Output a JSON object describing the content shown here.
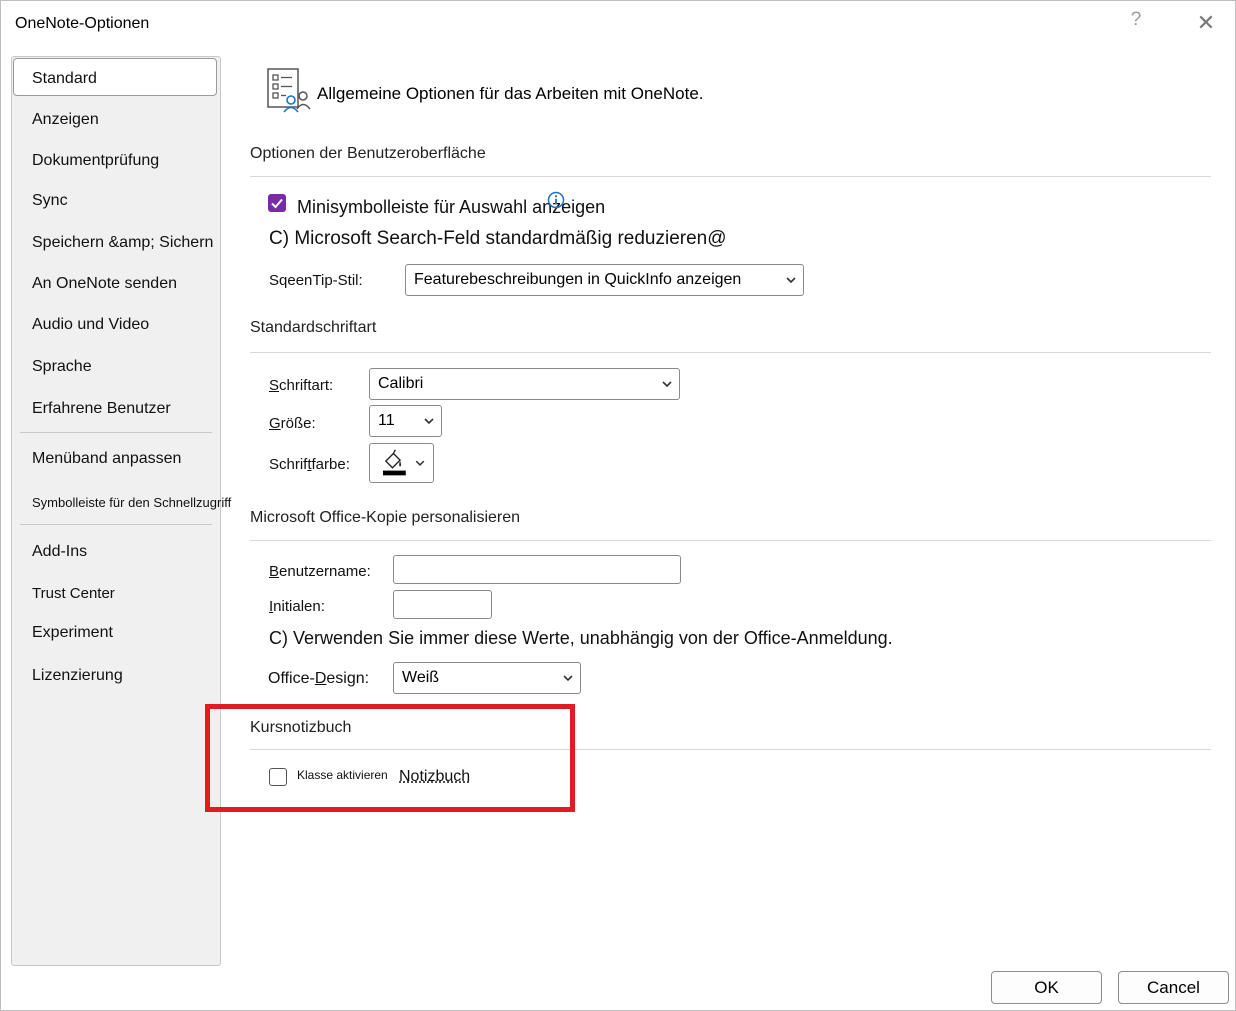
{
  "window": {
    "title": "OneNote-Optionen",
    "help_label": "?",
    "close_label": "✕"
  },
  "sidebar": {
    "items": [
      {
        "label": "Standard"
      },
      {
        "label": "Anzeigen"
      },
      {
        "label": "Dokumentprüfung"
      },
      {
        "label": "Sync"
      },
      {
        "label": "Speichern &amp; Sichern"
      },
      {
        "label": "An OneNote senden"
      },
      {
        "label": "Audio und Video"
      },
      {
        "label": "Sprache"
      },
      {
        "label": "Erfahrene Benutzer"
      },
      {
        "label": "Menüband anpassen"
      },
      {
        "label": "Symbolleiste für den Schnellzugriff"
      },
      {
        "label": "Add-Ins"
      },
      {
        "label": "Trust Center"
      },
      {
        "label": "Experiment"
      },
      {
        "label": "Lizenzierung"
      }
    ],
    "selected": "Standard"
  },
  "header": {
    "text": "Allgemeine Optionen für das Arbeiten mit OneNote.",
    "icon": "general-options-icon"
  },
  "ui_options": {
    "section_title": "Optionen der Benutzeroberfläche",
    "mini_toolbar_label": "Minisymbolleiste für Auswahl anzeigen",
    "mini_toolbar_checked": true,
    "search_collapse_label": "C) Microsoft Search-Feld standardmäßig reduzieren@",
    "screentip_label": "SqeenTip-Stil:",
    "screentip_value": "Featurebeschreibungen in QuickInfo anzeigen"
  },
  "default_font": {
    "section_title": "Standardschriftart",
    "font_label_u": "S",
    "font_label_rest": "chriftart:",
    "font_value": "Calibri",
    "size_label_u": "G",
    "size_label_rest": "röße:",
    "size_value": "11",
    "color_label_pre": "Schrif",
    "color_label_u": "t",
    "color_label_rest": "farbe:",
    "color_icon": "font-color-icon",
    "color_value": "#000000"
  },
  "personalize": {
    "section_title": "Microsoft Office-Kopie personalisieren",
    "username_label_u": "B",
    "username_label_rest": "enutzername:",
    "username_value": "",
    "initials_label_u": "I",
    "initials_label_rest": "nitialen:",
    "initials_value": "",
    "always_use_label": "C) Verwenden Sie immer diese Werte, unabhängig von der Office-Anmeldung.",
    "design_label_pre": "Office-",
    "design_label_u": "D",
    "design_label_rest": "esign:",
    "design_value": "Weiß"
  },
  "class_notebook": {
    "section_title": "Kursnotizbuch",
    "enable_label": "Klasse aktivieren",
    "enable_checked": false,
    "notebook_label": "Notizbuch"
  },
  "footer": {
    "ok_label": "OK",
    "cancel_label": "Cancel"
  },
  "colors": {
    "accent": "#7b2aa6",
    "highlight_box": "#e01b24"
  }
}
